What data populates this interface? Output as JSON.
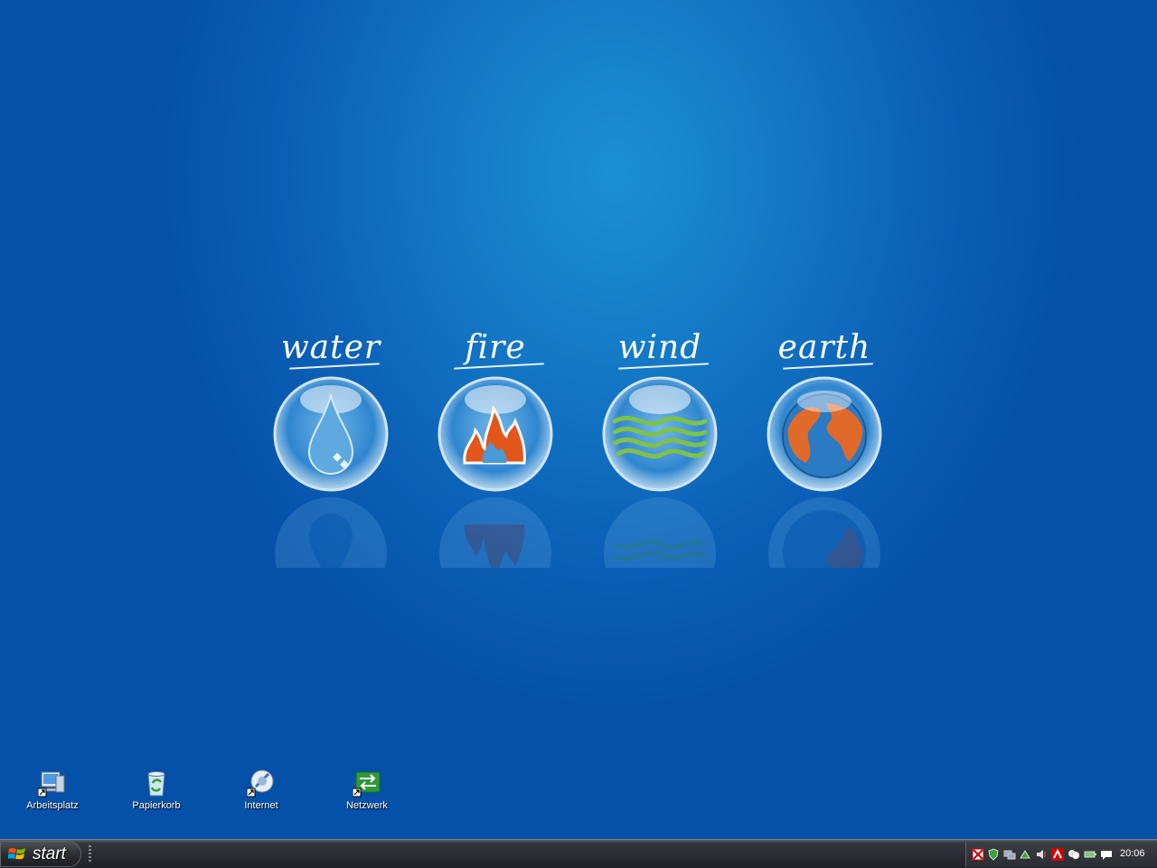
{
  "wallpaper": {
    "elements": [
      {
        "label": "water",
        "icon": "water-drop-icon"
      },
      {
        "label": "fire",
        "icon": "flame-icon"
      },
      {
        "label": "wind",
        "icon": "wind-waves-icon"
      },
      {
        "label": "earth",
        "icon": "globe-icon"
      }
    ]
  },
  "desktop_icons": [
    {
      "label": "Arbeitsplatz",
      "icon": "my-computer-icon"
    },
    {
      "label": "Papierkorb",
      "icon": "recycle-bin-icon"
    },
    {
      "label": "Internet",
      "icon": "internet-browser-icon"
    },
    {
      "label": "Netzwerk",
      "icon": "network-icon"
    }
  ],
  "taskbar": {
    "start_label": "start",
    "clock": "20:06",
    "tray_icons": [
      "security-alert-icon",
      "shield-icon",
      "network-status-icon",
      "update-icon",
      "volume-icon",
      "antivirus-icon",
      "messenger-icon",
      "battery-icon",
      "chat-icon"
    ]
  },
  "colors": {
    "desktop_blue": "#0b5fb6",
    "taskbar": "#2a2d33"
  }
}
